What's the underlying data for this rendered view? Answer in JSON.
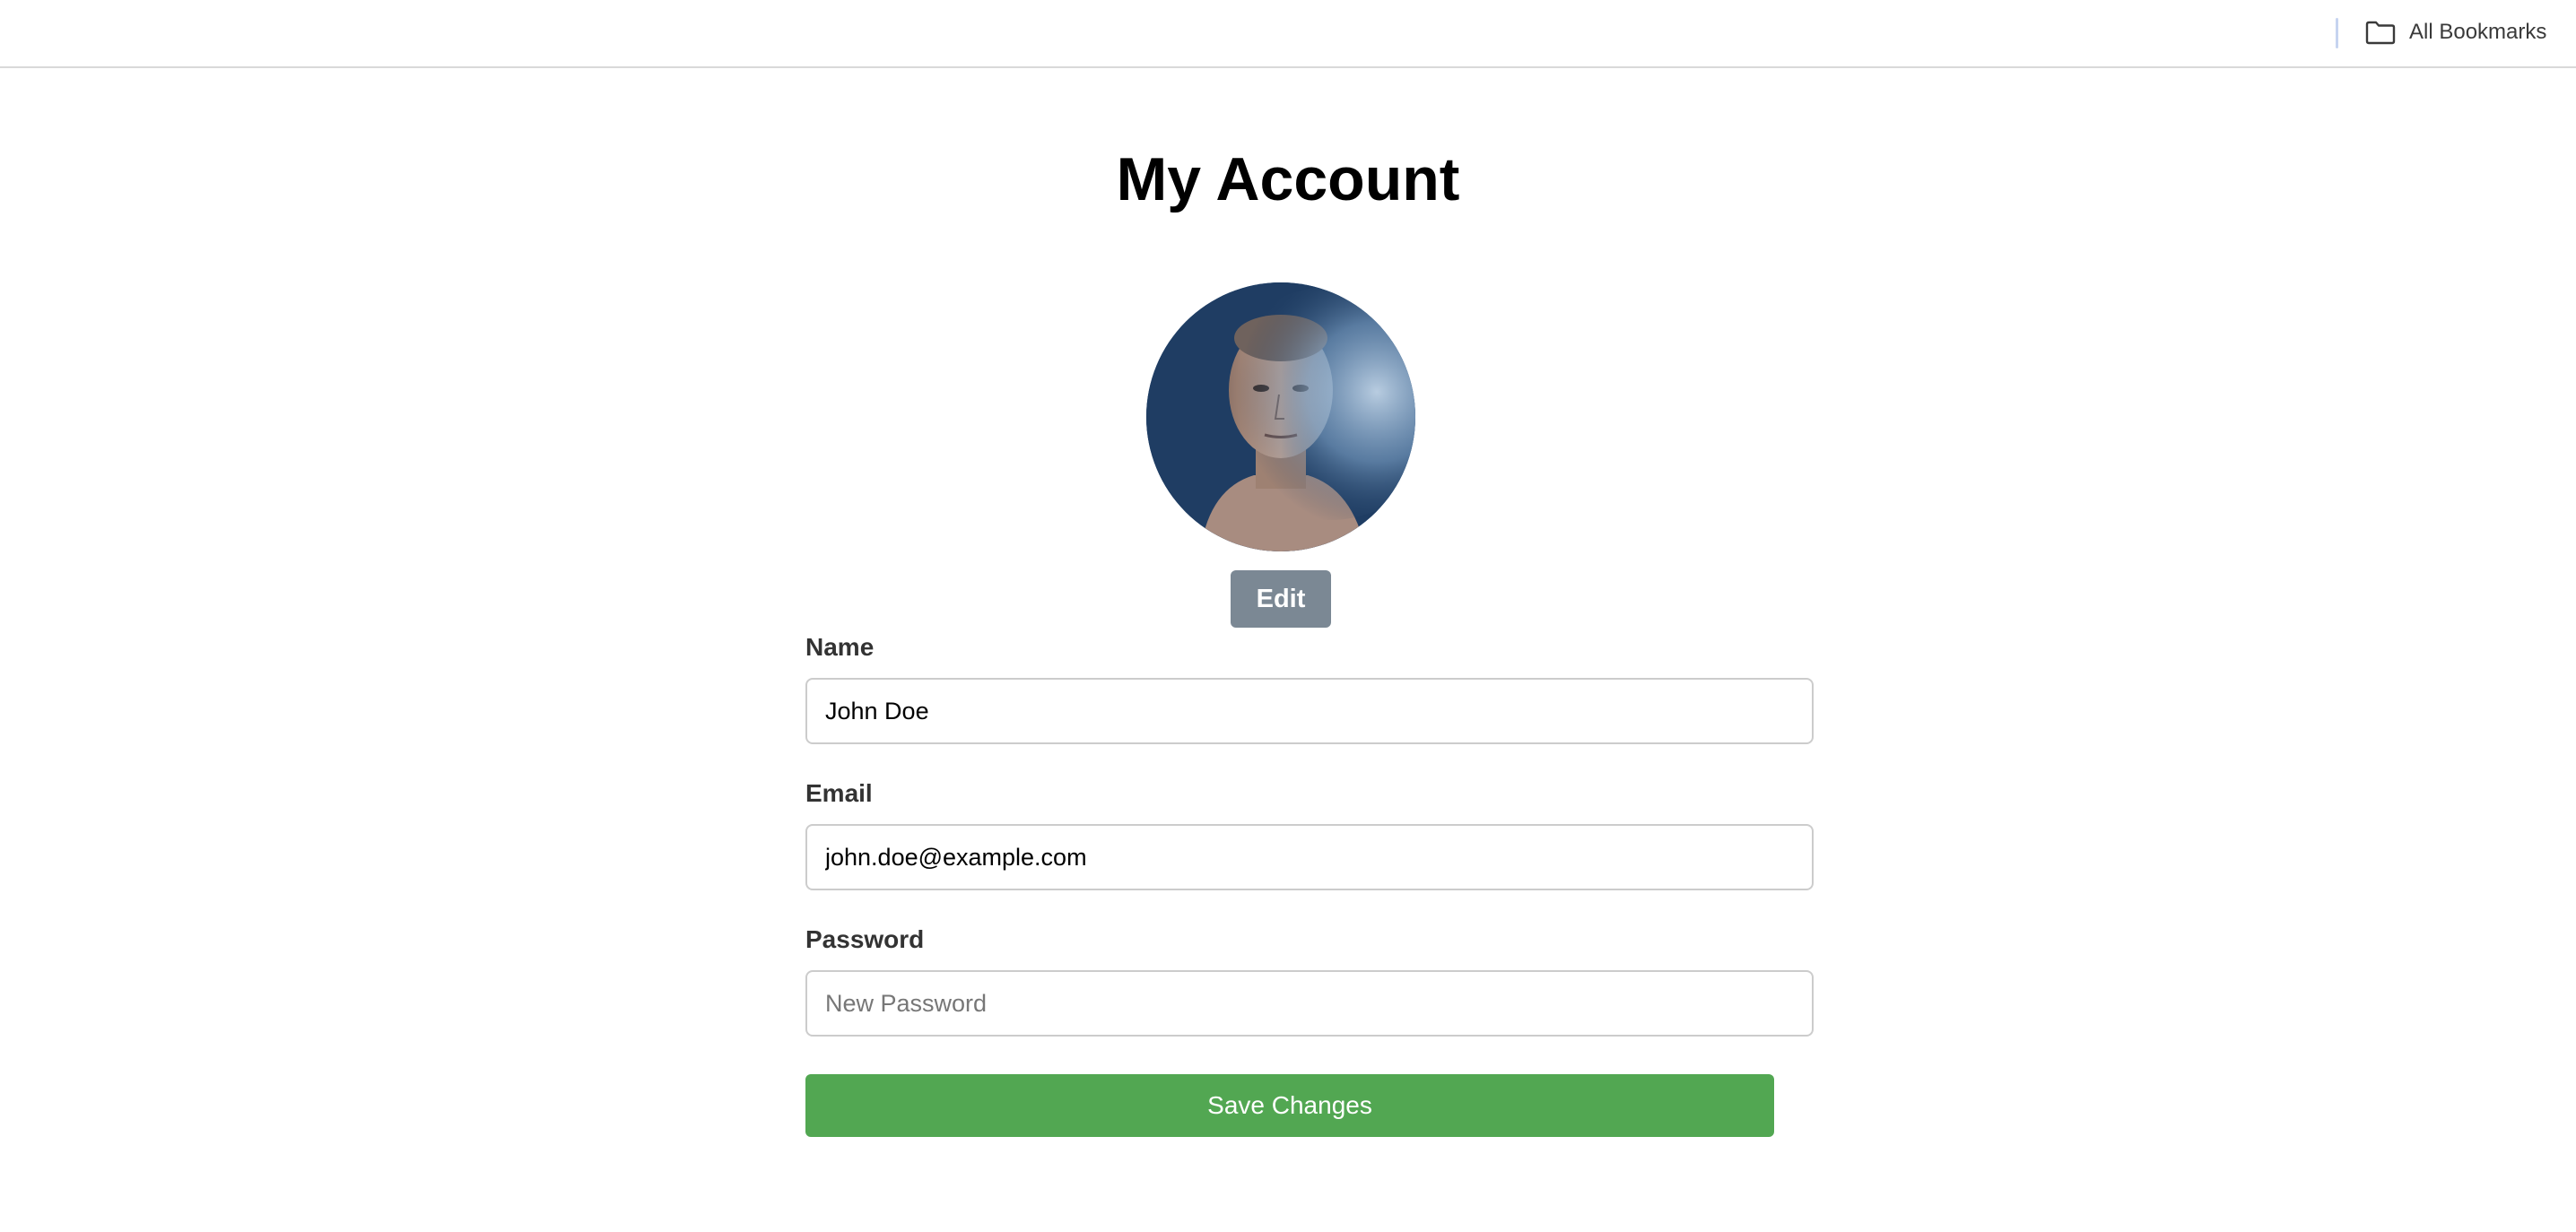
{
  "bookmarks_bar": {
    "all_bookmarks_label": "All Bookmarks",
    "icon": "folder-icon"
  },
  "page": {
    "title": "My Account"
  },
  "avatar": {
    "edit_label": "Edit"
  },
  "form": {
    "name": {
      "label": "Name",
      "value": "John Doe"
    },
    "email": {
      "label": "Email",
      "value": "john.doe@example.com"
    },
    "password": {
      "label": "Password",
      "value": "",
      "placeholder": "New Password"
    },
    "save_label": "Save Changes"
  },
  "colors": {
    "save_button": "#52a752",
    "edit_button": "#7b8894",
    "input_border": "#cccccc"
  }
}
